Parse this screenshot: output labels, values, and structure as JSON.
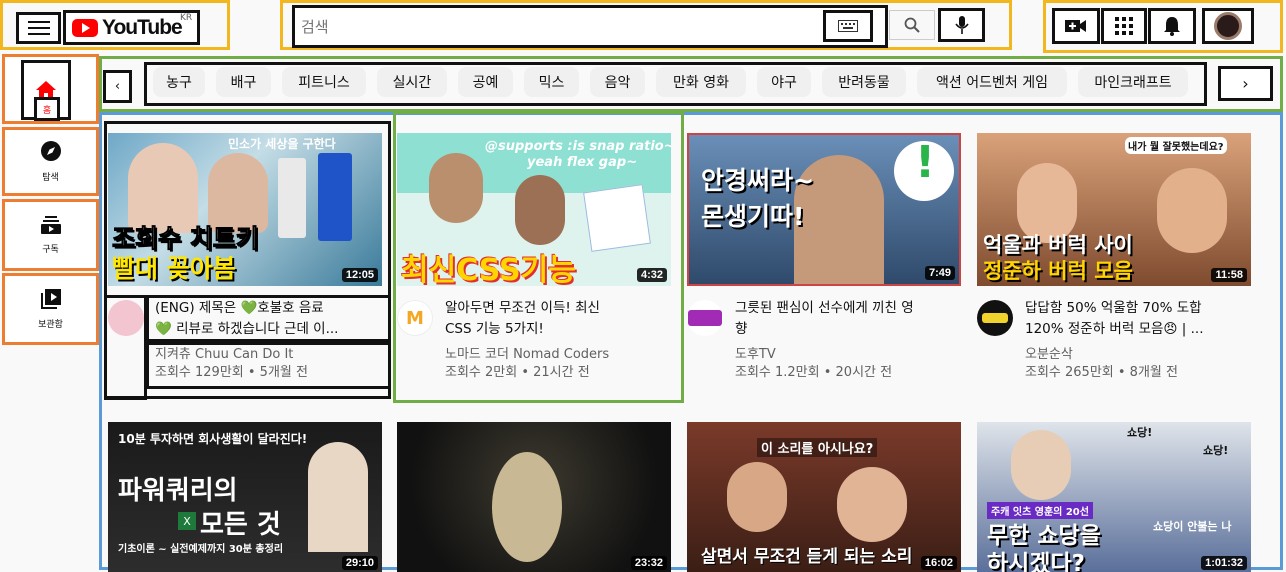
{
  "header": {
    "logo_text": "YouTube",
    "logo_region": "KR",
    "search_placeholder": "검색"
  },
  "sidebar": [
    {
      "label": "홈",
      "icon": "home-icon"
    },
    {
      "label": "탐색",
      "icon": "compass-icon"
    },
    {
      "label": "구독",
      "icon": "subscriptions-icon"
    },
    {
      "label": "보관함",
      "icon": "library-icon"
    }
  ],
  "chips": [
    "농구",
    "배구",
    "피트니스",
    "실시간",
    "공예",
    "믹스",
    "음악",
    "만화 영화",
    "야구",
    "반려동물",
    "액션 어드벤처 게임",
    "마인크래프트"
  ],
  "videos": [
    {
      "thumb_text": "조회수 치트키",
      "thumb_text2": "빨대 꽂아봄",
      "thumb_top": "민소가 세상을 구한다",
      "duration": "12:05",
      "title_line1": "(ENG) 제목은 💚호불호 음료",
      "title_line2": "💚 리뷰로 하겠습니다 근데 이...",
      "channel": "지켜츄 Chuu Can Do It",
      "meta": "조회수 129만회 • 5개월 전"
    },
    {
      "thumb_text": "최신CSS기능",
      "thumb_top": "@supports :is snap ratio~",
      "thumb_top2": "yeah flex gap~",
      "duration": "4:32",
      "title_line1": "알아두면 무조건 이득! 최신",
      "title_line2": "CSS 기능 5가지!",
      "channel": "노마드 코더 Nomad Coders",
      "meta": "조회수 2만회 • 21시간 전"
    },
    {
      "thumb_text": "안경써라~",
      "thumb_text2": "몬생기따!",
      "duration": "7:49",
      "title_line1": "그릇된 팬심이 선수에게 끼친 영",
      "title_line2": "향",
      "channel": "도후TV",
      "meta": "조회수 1.2만회 • 20시간 전"
    },
    {
      "thumb_text": "억울과 버럭 사이",
      "thumb_text2": "정준하 버럭 모음",
      "thumb_top": "내가 뭘 잘못했는데요?",
      "duration": "11:58",
      "title_line1": "답답함 50% 억울함 70% 도합",
      "title_line2": "120% 정준하 버럭 모음😠 | ...",
      "channel": "오분순삭",
      "meta": "조회수 265만회 • 8개월 전"
    },
    {
      "thumb_text": "파워쿼리의",
      "thumb_text2": "모든 것",
      "thumb_top": "10분 투자하면 회사생활이 달라진다!",
      "thumb_bot": "기초이론 ~ 실전예제까지 30분 총정리",
      "duration": "29:10"
    },
    {
      "duration": "23:32"
    },
    {
      "thumb_top": "이 소리를 아시나요?",
      "thumb_bot": "살면서 무조건 듣게 되는 소리",
      "duration": "16:02"
    },
    {
      "thumb_text": "무한 쇼당을",
      "thumb_text2": "하시겠다?",
      "thumb_top": "쇼당!",
      "thumb_top2": "쇼당!",
      "thumb_mid": "쇼당이 안불는 나",
      "thumb_tag": "주캐 잇츠 영훈의 20선",
      "duration": "1:01:32"
    }
  ]
}
